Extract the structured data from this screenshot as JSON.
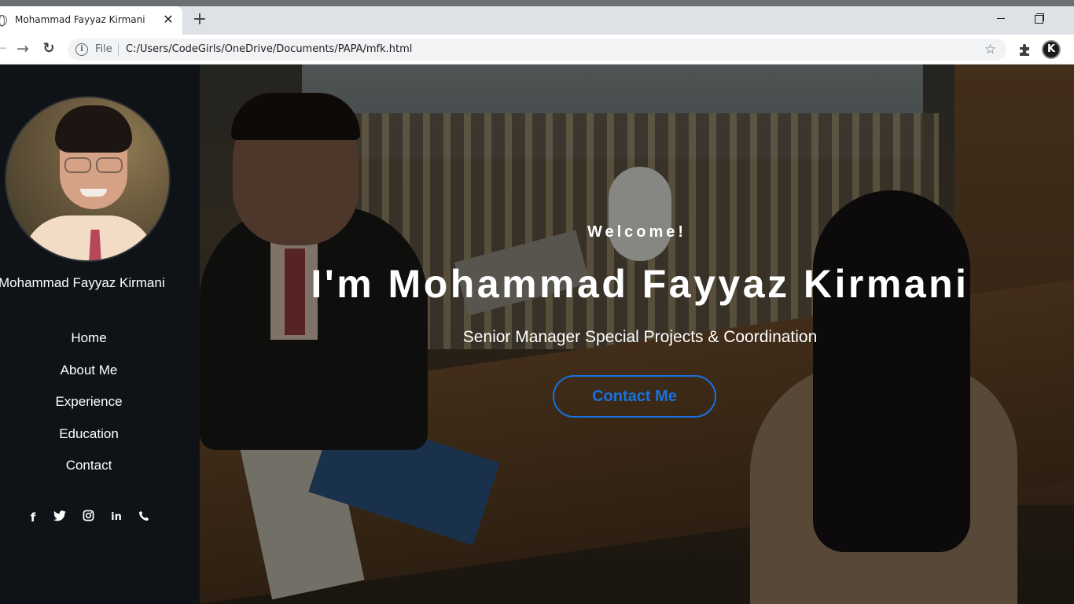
{
  "browser": {
    "tab_title": "Mohammad Fayyaz Kirmani",
    "tab_close": "✕",
    "new_tab": "+",
    "url_scheme": "File",
    "url": "C:/Users/CodeGirls/OneDrive/Documents/PAPA/mfk.html",
    "profile_initial": "K"
  },
  "sidebar": {
    "name": "Mohammad Fayyaz Kirmani",
    "nav": [
      "Home",
      "About Me",
      "Experience",
      "Education",
      "Contact"
    ],
    "social_icons": [
      "facebook-icon",
      "twitter-icon",
      "instagram-icon",
      "linkedin-icon",
      "phone-icon"
    ],
    "social_glyphs": [
      "f",
      "🐦",
      "◎",
      "in",
      "✆"
    ]
  },
  "hero": {
    "welcome": "Welcome!",
    "headline": "I'm Mohammad Fayyaz Kirmani",
    "subtitle": "Senior Manager Special Projects & Coordination",
    "cta": "Contact Me"
  },
  "colors": {
    "sidebar_bg": "#0f1317",
    "accent": "#1772e0",
    "text": "#ffffff"
  }
}
